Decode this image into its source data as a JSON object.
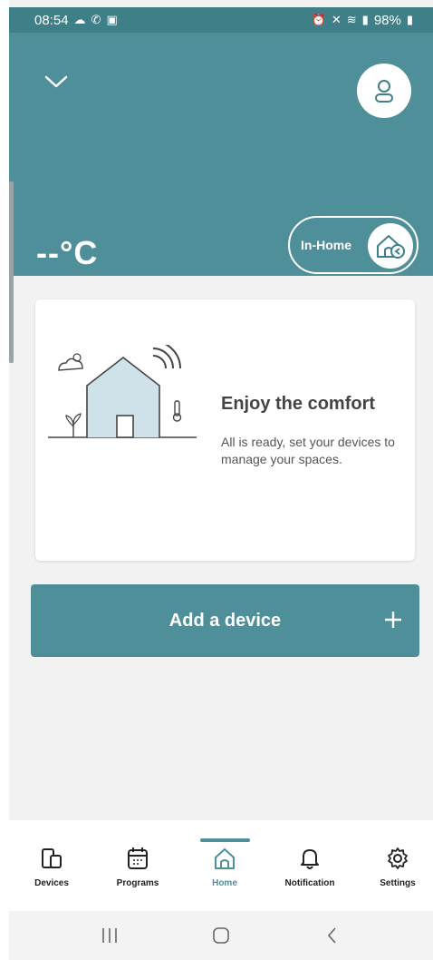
{
  "status_bar": {
    "time": "08:54",
    "battery": "98%",
    "left_icons": [
      "cloud-icon",
      "whatsapp-icon",
      "gallery-icon"
    ],
    "right_icons": [
      "alarm-icon",
      "alarm-clock-icon",
      "mute-icon",
      "wifi-icon",
      "signal-icon",
      "battery-icon"
    ]
  },
  "header": {
    "temperature": "--°C",
    "mode_label": "In-Home",
    "background_color": "#4e8f99"
  },
  "card": {
    "title": "Enjoy the comfort",
    "text": "All is ready, set your devices to manage your spaces."
  },
  "add_device": {
    "label": "Add a device",
    "icon": "plus-icon"
  },
  "bottom_nav": {
    "items": [
      {
        "label": "Devices",
        "icon": "devices-icon"
      },
      {
        "label": "Programs",
        "icon": "calendar-icon"
      },
      {
        "label": "Home",
        "icon": "home-icon",
        "active": true
      },
      {
        "label": "Notification",
        "icon": "bell-icon"
      },
      {
        "label": "Settings",
        "icon": "gear-icon"
      }
    ]
  },
  "system_nav": [
    "recents-button",
    "home-button",
    "back-button"
  ],
  "colors": {
    "accent": "#4e8f99",
    "status_bar": "#3f7f88",
    "background": "#f2f2f2"
  }
}
